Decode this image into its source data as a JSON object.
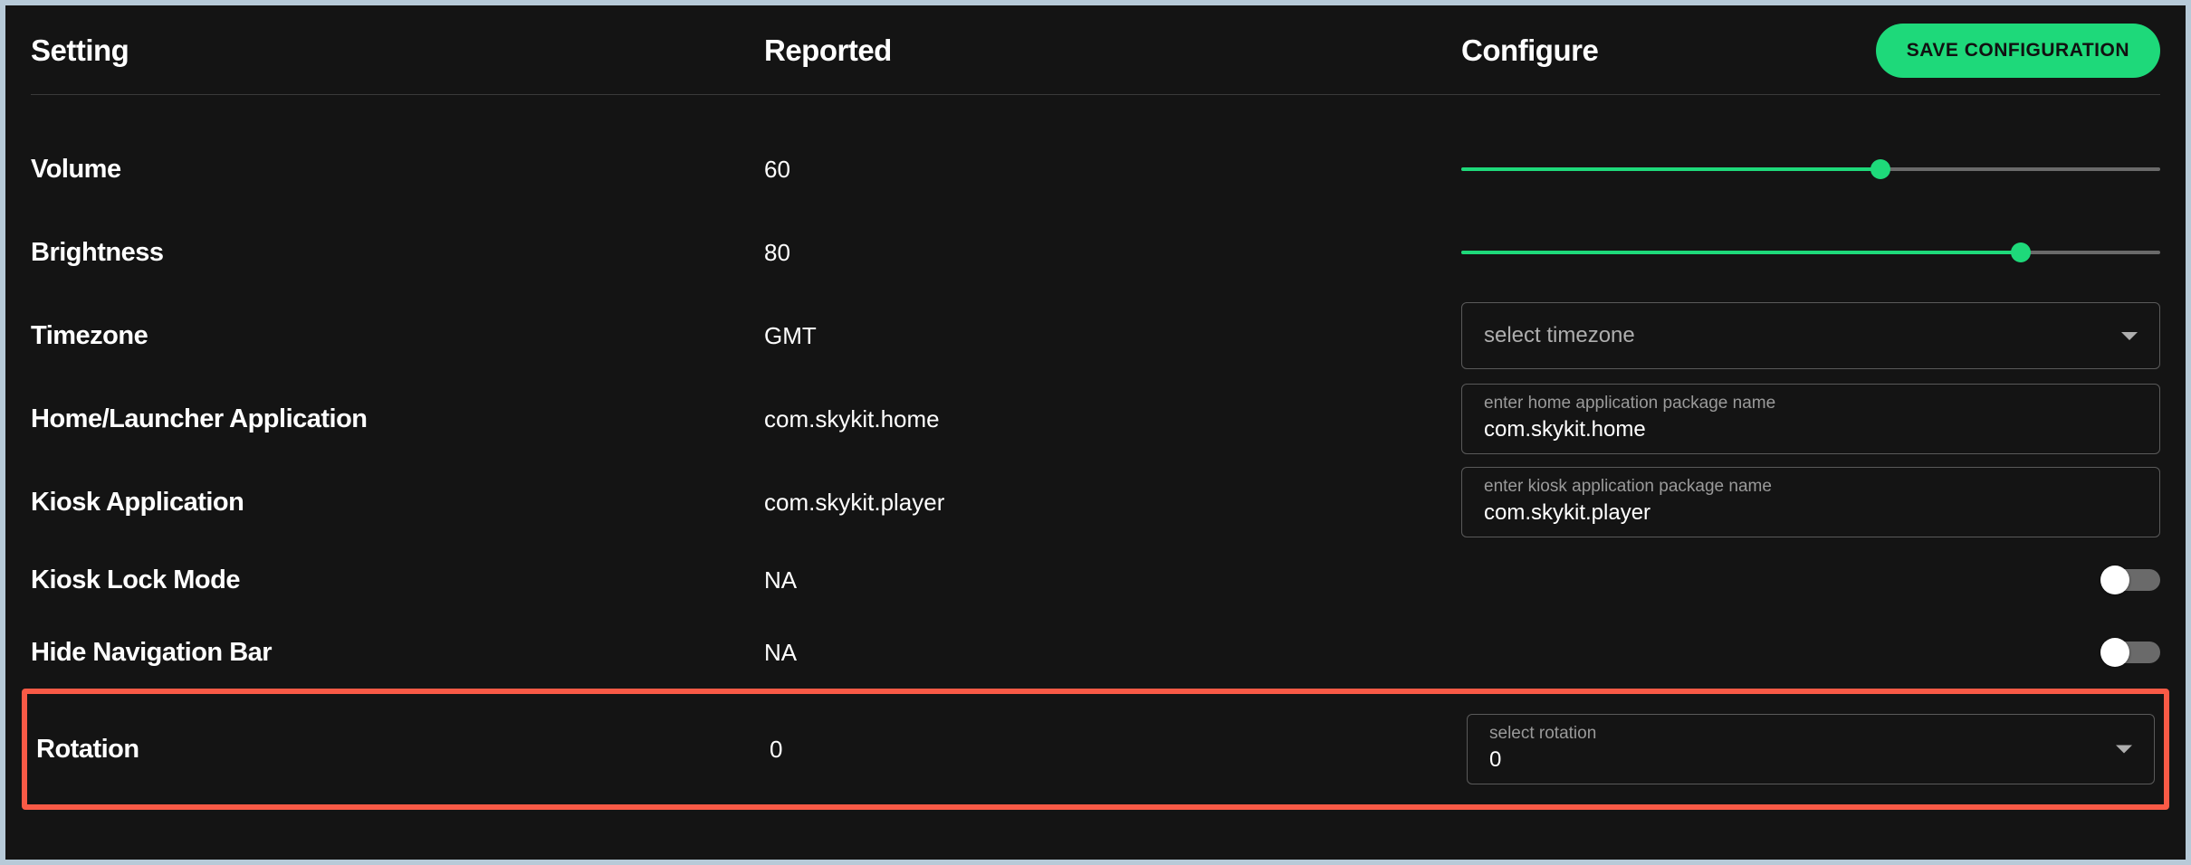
{
  "columns": {
    "setting": "Setting",
    "reported": "Reported",
    "configure": "Configure"
  },
  "actions": {
    "save": "SAVE CONFIGURATION"
  },
  "settings": {
    "volume": {
      "label": "Volume",
      "reported": "60",
      "slider_percent": 60
    },
    "brightness": {
      "label": "Brightness",
      "reported": "80",
      "slider_percent": 80
    },
    "timezone": {
      "label": "Timezone",
      "reported": "GMT",
      "placeholder": "select timezone"
    },
    "home_app": {
      "label": "Home/Launcher Application",
      "reported": "com.skykit.home",
      "field_label": "enter home application package name",
      "value": "com.skykit.home"
    },
    "kiosk_app": {
      "label": "Kiosk Application",
      "reported": "com.skykit.player",
      "field_label": "enter kiosk application package name",
      "value": "com.skykit.player"
    },
    "kiosk_lock": {
      "label": "Kiosk Lock Mode",
      "reported": "NA",
      "toggle_on": false
    },
    "hide_nav": {
      "label": "Hide Navigation Bar",
      "reported": "NA",
      "toggle_on": false
    },
    "rotation": {
      "label": "Rotation",
      "reported": "0",
      "field_label": "select rotation",
      "value": "0"
    }
  },
  "colors": {
    "accent": "#1ed97a",
    "highlight": "#f95a46"
  }
}
